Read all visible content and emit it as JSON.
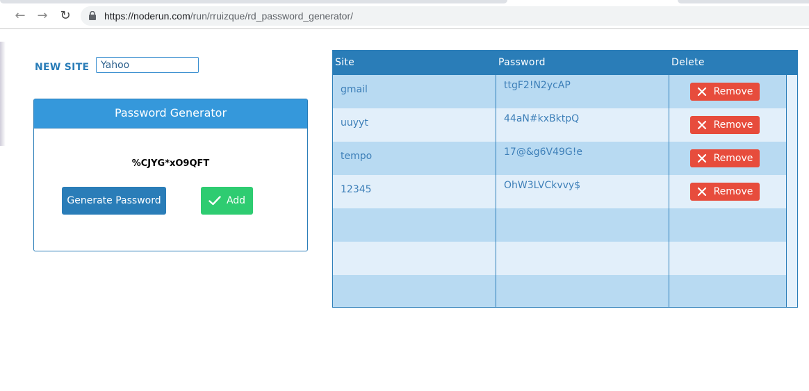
{
  "browser": {
    "url_host": "https://noderun.com",
    "url_path": "/run/rruizque/rd_password_generator/"
  },
  "new_site": {
    "label": "NEW SITE",
    "value": "Yahoo"
  },
  "generator": {
    "title": "Password Generator",
    "generated_password": "%CJYG*xO9QFT",
    "generate_label": "Generate Password",
    "add_label": "Add"
  },
  "table": {
    "columns": [
      "Site",
      "Password",
      "Delete"
    ],
    "remove_label": "Remove",
    "rows": [
      {
        "site": "gmail",
        "password": "ttgF2!N2ycAP"
      },
      {
        "site": "uuyyt",
        "password": "44aN#kxBktpQ"
      },
      {
        "site": "tempo",
        "password": "17@&g6V49G!e"
      },
      {
        "site": "12345",
        "password": "OhW3LVCkvvy$"
      }
    ]
  },
  "colors": {
    "accent": "#2a7db8",
    "header": "#3598db",
    "add": "#2ecc71",
    "remove": "#e74c3c"
  }
}
